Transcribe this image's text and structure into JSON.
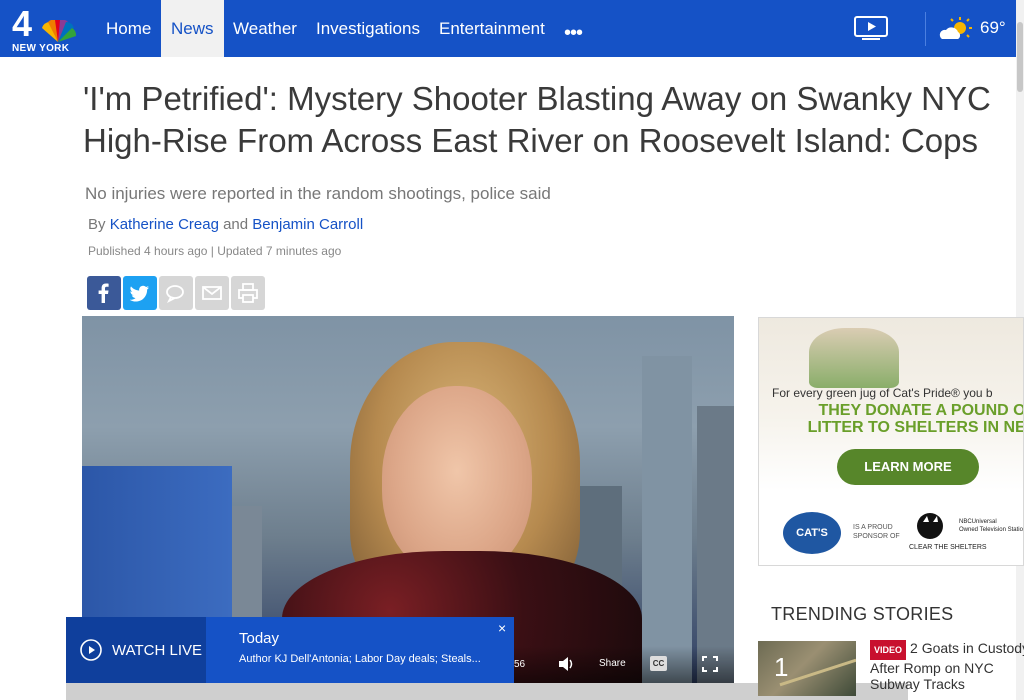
{
  "site": {
    "logo_text": "NEW YORK",
    "logo_number": "4"
  },
  "nav": {
    "items": [
      {
        "label": "Home"
      },
      {
        "label": "News"
      },
      {
        "label": "Weather"
      },
      {
        "label": "Investigations"
      },
      {
        "label": "Entertainment"
      }
    ],
    "more_label": "•••",
    "temperature": "69°",
    "accent_color": "#1552c6"
  },
  "article": {
    "headline_line1": "'I'm Petrified': Mystery Shooter Blasting Away on Swanky NYC",
    "headline_line2": "High-Rise From Across East River on Roosevelt Island: Cops",
    "subhead": "No injuries were reported in the random shootings, police said",
    "by": "By",
    "author1": "Katherine Creag",
    "and": "and",
    "author2": "Benjamin Carroll",
    "published": "Published 4 hours ago | Updated 7 minutes ago"
  },
  "share": {
    "icons": [
      "facebook-icon",
      "twitter-icon",
      "comment-icon",
      "email-icon",
      "print-icon"
    ]
  },
  "video": {
    "time": "56",
    "share_label": "Share",
    "cc_label": "CC"
  },
  "watch_live": {
    "label": "WATCH LIVE",
    "show": "Today",
    "description": "Author KJ Dell'Antonia; Labor Day deals; Steals...",
    "close": "×"
  },
  "ad": {
    "intro": "For every green jug of Cat's Pride® you b",
    "headline_line1": "THEY DONATE A POUND O",
    "headline_line2": "LITTER TO SHELTERS IN NEE",
    "cta": "LEARN MORE",
    "brand": "CAT'S PRIDE",
    "sponsor_text": "IS A PROUD SPONSOR OF",
    "charity": "CLEAR THE SHELTERS",
    "nbcu_line1": "NBCUniversal",
    "nbcu_line2": "Owned Television Stations"
  },
  "trending": {
    "title": "TRENDING STORIES",
    "items": [
      {
        "rank": "1",
        "badge": "VIDEO",
        "text": "2 Goats in Custody After Romp on NYC Subway Tracks"
      }
    ]
  }
}
